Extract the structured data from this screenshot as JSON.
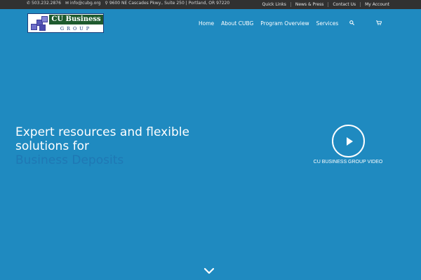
{
  "topbar": {
    "phone": "503.232.2876",
    "email": "info@cubg.org",
    "address": "9600 NE Cascades Pkwy., Suite 250 | Portland, OR 97220",
    "links": [
      "Quick Links",
      "News & Press",
      "Contact Us",
      "My Account"
    ]
  },
  "logo": {
    "line1": "CU Business",
    "line2": "GROUP"
  },
  "nav": {
    "items": [
      "Home",
      "About CUBG",
      "Program Overview",
      "Services"
    ],
    "search_icon": "search-icon",
    "cart_icon": "cart-icon"
  },
  "hero": {
    "title": "Expert resources and flexible solutions for",
    "rotating_text": "Business Deposits",
    "video_label": "CU BUSINESS GROUP VIDEO"
  },
  "colors": {
    "background": "#1f8ac0",
    "topbar": "#313131",
    "rotating_text": "#1f78b4"
  }
}
